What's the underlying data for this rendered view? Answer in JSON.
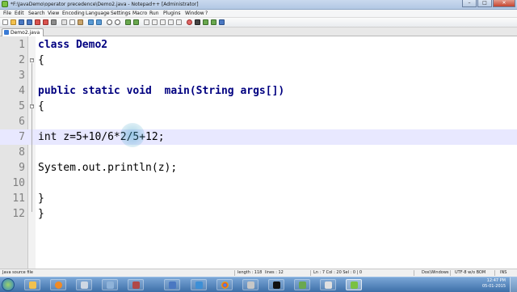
{
  "window": {
    "title": "*F:\\JavaDemo\\operator precedence\\Demo2.java - Notepad++ [Administrator]",
    "min_glyph": "–",
    "max_glyph": "□",
    "close_glyph": "✕"
  },
  "menu": [
    "File",
    "Edit",
    "Search",
    "View",
    "Encoding",
    "Language",
    "Settings",
    "Macro",
    "Run",
    "Plugins",
    "Window",
    "?"
  ],
  "tab": {
    "label": "Demo2.java"
  },
  "editor": {
    "current_line": 7,
    "lines": [
      {
        "n": "1",
        "text": "class Demo2"
      },
      {
        "n": "2",
        "text": "{"
      },
      {
        "n": "3",
        "text": ""
      },
      {
        "n": "4",
        "text": "public static void  main(String args[])"
      },
      {
        "n": "5",
        "text": "{"
      },
      {
        "n": "6",
        "text": ""
      },
      {
        "n": "7",
        "text": "int z=5+10/6*2/5+12;"
      },
      {
        "n": "8",
        "text": ""
      },
      {
        "n": "9",
        "text": "System.out.println(z);"
      },
      {
        "n": "10",
        "text": ""
      },
      {
        "n": "11",
        "text": "}"
      },
      {
        "n": "12",
        "text": "}"
      }
    ]
  },
  "status": {
    "file_type": "Java source file",
    "length": "length : 118",
    "lines": "lines : 12",
    "position": "Ln : 7    Col : 20    Sel : 0 | 0",
    "eol": "Dos\\Windows",
    "encoding": "UTF-8 w/o BOM",
    "mode": "INS"
  },
  "taskbar": {
    "time": "12:47 PM",
    "date": "05-01-2015"
  },
  "colors": {
    "keyword": "#000080",
    "current_line_bg": "#e8e8ff",
    "gutter_bg": "#e4e4e4",
    "taskbar_top": "#7aa6d6"
  }
}
